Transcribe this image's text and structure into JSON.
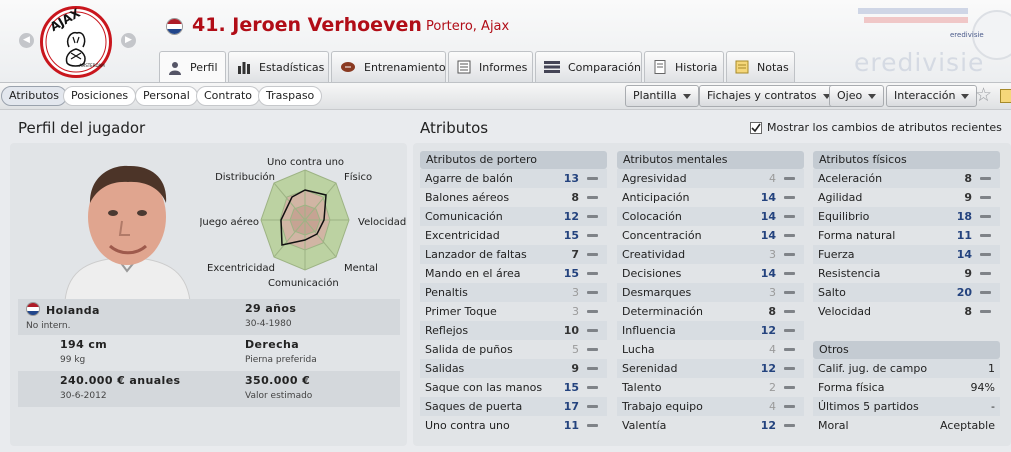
{
  "header": {
    "player_name": "41. Jeroen Verhoeven",
    "player_role": "Portero, Ajax",
    "club_logo_text": "AJAX",
    "club_logo_subtext": "AMSTERDAM",
    "league_brand": "eredivisie",
    "tabs": [
      {
        "label": "Perfil",
        "icon": "player-icon",
        "active": true
      },
      {
        "label": "Estadísticas",
        "icon": "bar-chart-icon",
        "active": false
      },
      {
        "label": "Entrenamiento",
        "icon": "ball-icon",
        "active": false
      },
      {
        "label": "Informes",
        "icon": "report-icon",
        "active": false
      },
      {
        "label": "Comparación",
        "icon": "compare-icon",
        "active": false
      },
      {
        "label": "Historia",
        "icon": "history-icon",
        "active": false
      },
      {
        "label": "Notas",
        "icon": "notes-icon",
        "active": false
      }
    ]
  },
  "subnav": {
    "pills": [
      {
        "label": "Atributos",
        "active": true
      },
      {
        "label": "Posiciones",
        "active": false
      },
      {
        "label": "Personal",
        "active": false
      },
      {
        "label": "Contrato",
        "active": false
      },
      {
        "label": "Traspaso",
        "active": false
      }
    ],
    "dropdowns": [
      "Plantilla",
      "Fichajes y contratos",
      "Ojeo",
      "Interacción"
    ]
  },
  "profile": {
    "title": "Perfil del jugador",
    "radar_labels": [
      "Uno contra uno",
      "Físico",
      "Velocidad",
      "Mental",
      "Comunicación",
      "Excentricidad",
      "Juego aéreo",
      "Distribución"
    ],
    "info": [
      [
        {
          "main": "Holanda",
          "sub": "No intern."
        },
        {
          "main": "29 años",
          "sub": "30-4-1980"
        }
      ],
      [
        {
          "main": "194 cm",
          "sub": "99 kg"
        },
        {
          "main": "Derecha",
          "sub": "Pierna preferida"
        }
      ],
      [
        {
          "main": "240.000 € anuales",
          "sub": "30-6-2012"
        },
        {
          "main": "350.000 €",
          "sub": "Valor estimado"
        }
      ]
    ]
  },
  "attributes": {
    "title": "Atributos",
    "show_changes_label": "Mostrar los cambios de atributos recientes",
    "goalkeeper": {
      "title": "Atributos de portero",
      "items": [
        {
          "name": "Agarre de balón",
          "value": "13"
        },
        {
          "name": "Balones aéreos",
          "value": "8"
        },
        {
          "name": "Comunicación",
          "value": "12"
        },
        {
          "name": "Excentricidad",
          "value": "15"
        },
        {
          "name": "Lanzador de faltas",
          "value": "7"
        },
        {
          "name": "Mando en el área",
          "value": "15"
        },
        {
          "name": "Penaltis",
          "value": "3"
        },
        {
          "name": "Primer Toque",
          "value": "3"
        },
        {
          "name": "Reflejos",
          "value": "10"
        },
        {
          "name": "Salida de puños",
          "value": "5"
        },
        {
          "name": "Salidas",
          "value": "9"
        },
        {
          "name": "Saque con las manos",
          "value": "15"
        },
        {
          "name": "Saques de puerta",
          "value": "17"
        },
        {
          "name": "Uno contra uno",
          "value": "11"
        }
      ]
    },
    "mental": {
      "title": "Atributos mentales",
      "items": [
        {
          "name": "Agresividad",
          "value": "4"
        },
        {
          "name": "Anticipación",
          "value": "14"
        },
        {
          "name": "Colocación",
          "value": "14"
        },
        {
          "name": "Concentración",
          "value": "14"
        },
        {
          "name": "Creatividad",
          "value": "3"
        },
        {
          "name": "Decisiones",
          "value": "14"
        },
        {
          "name": "Desmarques",
          "value": "3"
        },
        {
          "name": "Determinación",
          "value": "8"
        },
        {
          "name": "Influencia",
          "value": "12"
        },
        {
          "name": "Lucha",
          "value": "4"
        },
        {
          "name": "Serenidad",
          "value": "12"
        },
        {
          "name": "Talento",
          "value": "2"
        },
        {
          "name": "Trabajo equipo",
          "value": "4"
        },
        {
          "name": "Valentía",
          "value": "12"
        }
      ]
    },
    "physical": {
      "title": "Atributos físicos",
      "items": [
        {
          "name": "Aceleración",
          "value": "8"
        },
        {
          "name": "Agilidad",
          "value": "9"
        },
        {
          "name": "Equilibrio",
          "value": "18"
        },
        {
          "name": "Forma natural",
          "value": "11"
        },
        {
          "name": "Fuerza",
          "value": "14"
        },
        {
          "name": "Resistencia",
          "value": "9"
        },
        {
          "name": "Salto",
          "value": "20"
        },
        {
          "name": "Velocidad",
          "value": "8"
        }
      ]
    },
    "other": {
      "title": "Otros",
      "items": [
        {
          "name": "Calif. jug. de campo",
          "value": "1"
        },
        {
          "name": "Forma física",
          "value": "94%"
        },
        {
          "name": "Últimos 5 partidos",
          "value": "-"
        },
        {
          "name": "Moral",
          "value": "Aceptable"
        }
      ]
    }
  },
  "colors": {
    "name_red": "#b10d17",
    "value_blue": "#24437e",
    "value_gray": "#9a9a9a",
    "value_dark": "#333333"
  }
}
